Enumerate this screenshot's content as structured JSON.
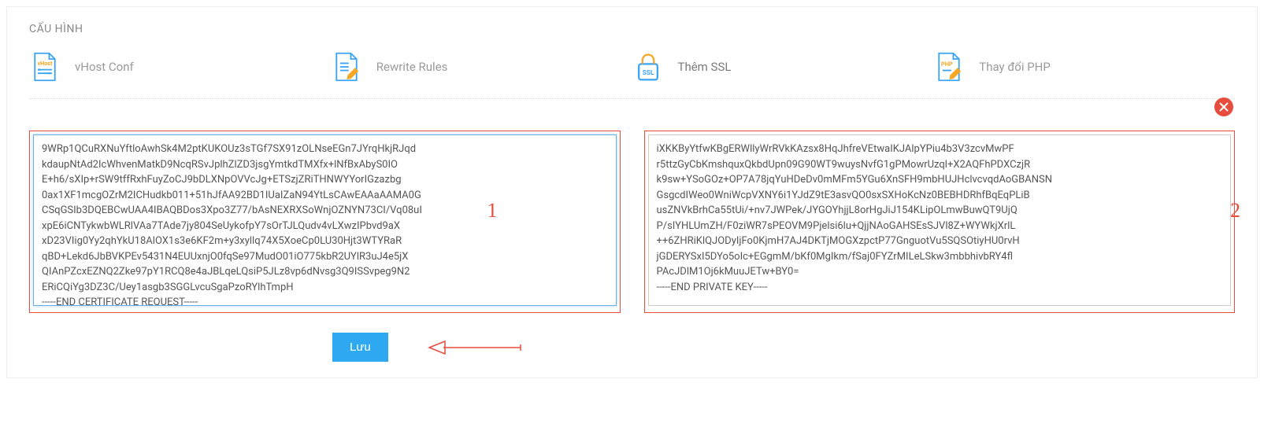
{
  "card": {
    "title": "CẤU HÌNH"
  },
  "tabs": [
    {
      "id": "vhost-conf",
      "label": "vHost Conf"
    },
    {
      "id": "rewrite-rules",
      "label": "Rewrite Rules"
    },
    {
      "id": "add-ssl",
      "label": "Thêm SSL"
    },
    {
      "id": "change-php",
      "label": "Thay đổi PHP"
    }
  ],
  "textareas": {
    "certificate_request": "9WRp1QCuRXNuYftloAwhSk4M2ptKUKOUz3sTGf7SX91zOLNseEGn7JYrqHkjRJqd\nkdaupNtAd2IcWhvenMatkD9NcqRSvJplhZlZD3jsgYmtkdTMXfx+lNfBxAbyS0IO\nE+h6/sXIp+rSW9tffRxhFuyZoCJ9bDLXNpOVVcJg+ETSzjZRiTHNWYYorIGzazbg\n0ax1XF1mcgOZrM2ICHudkb011+51hJfAA92BD1IUaIZaN94YtLsCAwEAAaAAMA0G\nCSqGSIb3DQEBCwUAA4IBAQBDos3Xpo3Z77/bAsNEXRXSoWnjOZNYN73CI/Vq08uI\nxpE6iCNTykwbWLRlVAa7TAde7jy804SeUykofpY7sOrTJLQudv4vLXwzIPbvd9aX\nxD23VIig0Yy2qhYkU18AlOX1s3e6KF2m+y3xyllq74X5XoeCp0LU30Hjt3WTYRaR\nqBD+Lekd6JbBVKPEv5431N4EUUxnjO0fqSe97MudO01iO775kbR2UYlR3uJ4e5jX\nQIAnPZcxEZNQ2Zke97pY1RCQ8e4aJBLqeLQsiP5JLz8vp6dNvsg3Q9ISSvpeg9N2\nERiCQiYg3DZ3C/Uey1asgb3SGGLvcuSgaPzoRYlhTmpH\n-----END CERTIFICATE REQUEST-----",
    "private_key": "iXKKByYtfwKBgERWllyWrRVkKAzsx8HqJhfreVEtwaIKJAlpYPiu4b3V3zcvMwPF\nr5ttzGyCbKmshquxQkbdUpn09G90WT9wuysNvfG1gPMowrUzql+X2AQFhPDXCzjR\nk9sw+YSoGOz+OP7A78jqYuHDeDv0mMFm5YGu6XnSFH9mbHUJHclvcvqdAoGBANSN\nGsgcdIWeo0WniWcpVXNY6i1YJdZ9tE3asvQO0sxSXHoKcNz0BEBHDRhfBqEqPLiB\nusZNVkBrhCa55tUi/+nv7JWPek/JYGOYhjjL8orHgJiJ154KLipOLmwBuwQT9UjQ\nP/sIYHLUmZH/F0ziWR7sPEOVM9Pjelsi6lu+QjjNAoGAHSEsSJVl8Z+WYWkjXrlL\n++6ZHRiKlQJODyIjFo0KjmH7AJ4DKTjMOGXzpctP77GnguotVu5SQSOtiyHU0rvH\njGDERYSxI5DYo5oIc+EGgmM/bKf0MgIkm/fSaj0FYZrMILeLSkw3mbbhivbRY4fl\nPAcJDlM1Oj6kMuuJETw+BY0=\n-----END PRIVATE KEY-----"
  },
  "annotations": {
    "box1": "1",
    "box2": "2"
  },
  "footer": {
    "save_label": "Lưu"
  }
}
